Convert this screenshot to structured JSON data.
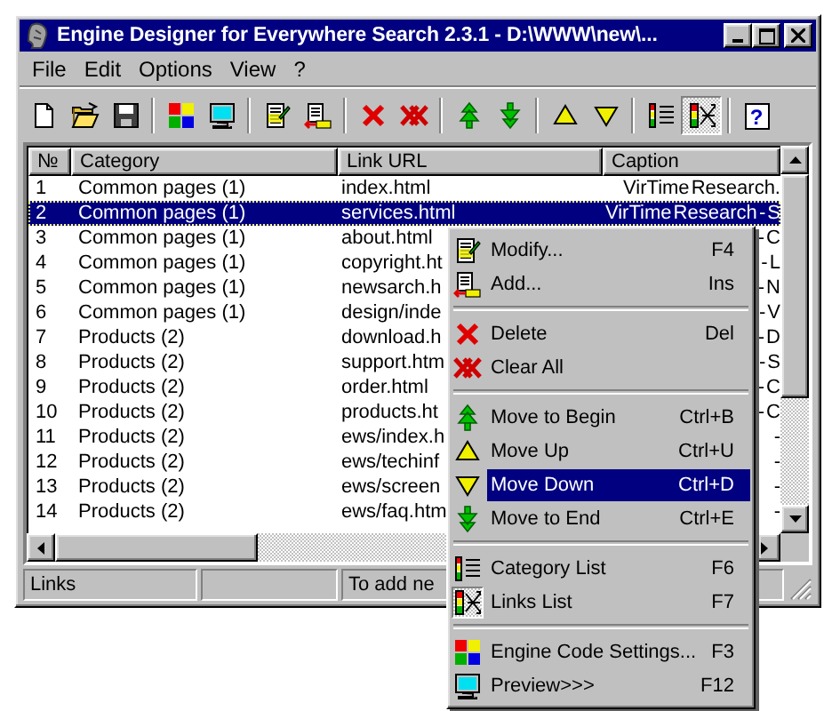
{
  "window": {
    "title": "Engine Designer for Everywhere Search 2.3.1 - D:\\WWW\\new\\..."
  },
  "menu_bar": [
    "File",
    "Edit",
    "Options",
    "View",
    "?"
  ],
  "toolbar": {
    "groups": [
      [
        {
          "pressed": false
        },
        {
          "pressed": false
        },
        {
          "pressed": false
        }
      ],
      [
        {
          "pressed": false
        },
        {
          "pressed": false
        }
      ],
      [
        {
          "pressed": false
        },
        {
          "pressed": false
        }
      ],
      [
        {
          "pressed": false
        },
        {
          "pressed": false
        }
      ],
      [
        {
          "pressed": false
        },
        {
          "pressed": false
        }
      ],
      [
        {
          "pressed": false
        },
        {
          "pressed": false
        }
      ],
      [
        {
          "pressed": false
        },
        {
          "pressed": true
        }
      ],
      [
        {
          "pressed": false,
          "glyph": "?"
        }
      ]
    ]
  },
  "list": {
    "columns": [
      "№",
      "Category",
      "Link URL",
      "Caption"
    ],
    "rows": [
      {
        "number": "1",
        "category": "Common pages (1)",
        "url": "index.html",
        "caption": "VirTime Research.",
        "selected": false
      },
      {
        "number": "2",
        "category": "Common pages (1)",
        "url": "services.html",
        "caption": "VirTime Research - S",
        "selected": true
      },
      {
        "number": "3",
        "category": "Common pages (1)",
        "url": "about.html",
        "caption": "- C",
        "selected": false
      },
      {
        "number": "4",
        "category": "Common pages (1)",
        "url": "copyright.ht",
        "caption": "- L",
        "selected": false
      },
      {
        "number": "5",
        "category": "Common pages (1)",
        "url": "newsarch.h",
        "caption": "- N",
        "selected": false
      },
      {
        "number": "6",
        "category": "Common pages (1)",
        "url": "design/inde",
        "caption": "- V",
        "selected": false
      },
      {
        "number": "7",
        "category": "Products (2)",
        "url": "download.h",
        "caption": "- D",
        "selected": false
      },
      {
        "number": "8",
        "category": "Products (2)",
        "url": "support.htm",
        "caption": "- S",
        "selected": false
      },
      {
        "number": "9",
        "category": "Products (2)",
        "url": "order.html",
        "caption": "- C",
        "selected": false
      },
      {
        "number": "10",
        "category": "Products (2)",
        "url": "products.ht",
        "caption": "- C",
        "selected": false
      },
      {
        "number": "11",
        "category": "Products (2)",
        "url": "ews/index.h",
        "caption": "-",
        "selected": false
      },
      {
        "number": "12",
        "category": "Products (2)",
        "url": "ews/techinf",
        "caption": "-",
        "selected": false
      },
      {
        "number": "13",
        "category": "Products (2)",
        "url": "ews/screen",
        "caption": "-",
        "selected": false
      },
      {
        "number": "14",
        "category": "Products (2)",
        "url": "ews/faq.htm",
        "caption": "-",
        "selected": false
      }
    ]
  },
  "status_bar": {
    "panels": [
      {
        "kind": "text",
        "text": "Links"
      },
      {
        "kind": "empty"
      },
      {
        "kind": "text",
        "text": "To add ne"
      }
    ]
  },
  "context_menu": {
    "items": [
      {
        "kind": "item",
        "label": "Modify...",
        "shortcut": "F4",
        "selected": false,
        "checked": false
      },
      {
        "kind": "item",
        "label": "Add...",
        "shortcut": "Ins",
        "selected": false,
        "checked": false
      },
      {
        "kind": "separator"
      },
      {
        "kind": "item",
        "label": "Delete",
        "shortcut": "Del",
        "selected": false,
        "checked": false
      },
      {
        "kind": "item",
        "label": "Clear All",
        "selected": false,
        "checked": false
      },
      {
        "kind": "separator"
      },
      {
        "kind": "item",
        "label": "Move to Begin",
        "shortcut": "Ctrl+B",
        "selected": false,
        "checked": false
      },
      {
        "kind": "item",
        "label": "Move Up",
        "shortcut": "Ctrl+U",
        "selected": false,
        "checked": false
      },
      {
        "kind": "item",
        "label": "Move Down",
        "shortcut": "Ctrl+D",
        "selected": true,
        "checked": false
      },
      {
        "kind": "item",
        "label": "Move to End",
        "shortcut": "Ctrl+E",
        "selected": false,
        "checked": false
      },
      {
        "kind": "separator"
      },
      {
        "kind": "item",
        "label": "Category List",
        "shortcut": "F6",
        "selected": false,
        "checked": false
      },
      {
        "kind": "item",
        "label": "Links List",
        "shortcut": "F7",
        "selected": false,
        "checked": true
      },
      {
        "kind": "separator"
      },
      {
        "kind": "item",
        "label": "Engine Code Settings...",
        "shortcut": "F3",
        "selected": false,
        "checked": false
      },
      {
        "kind": "item",
        "label": "Preview>>>",
        "shortcut": "F12",
        "selected": false,
        "checked": false
      }
    ]
  }
}
